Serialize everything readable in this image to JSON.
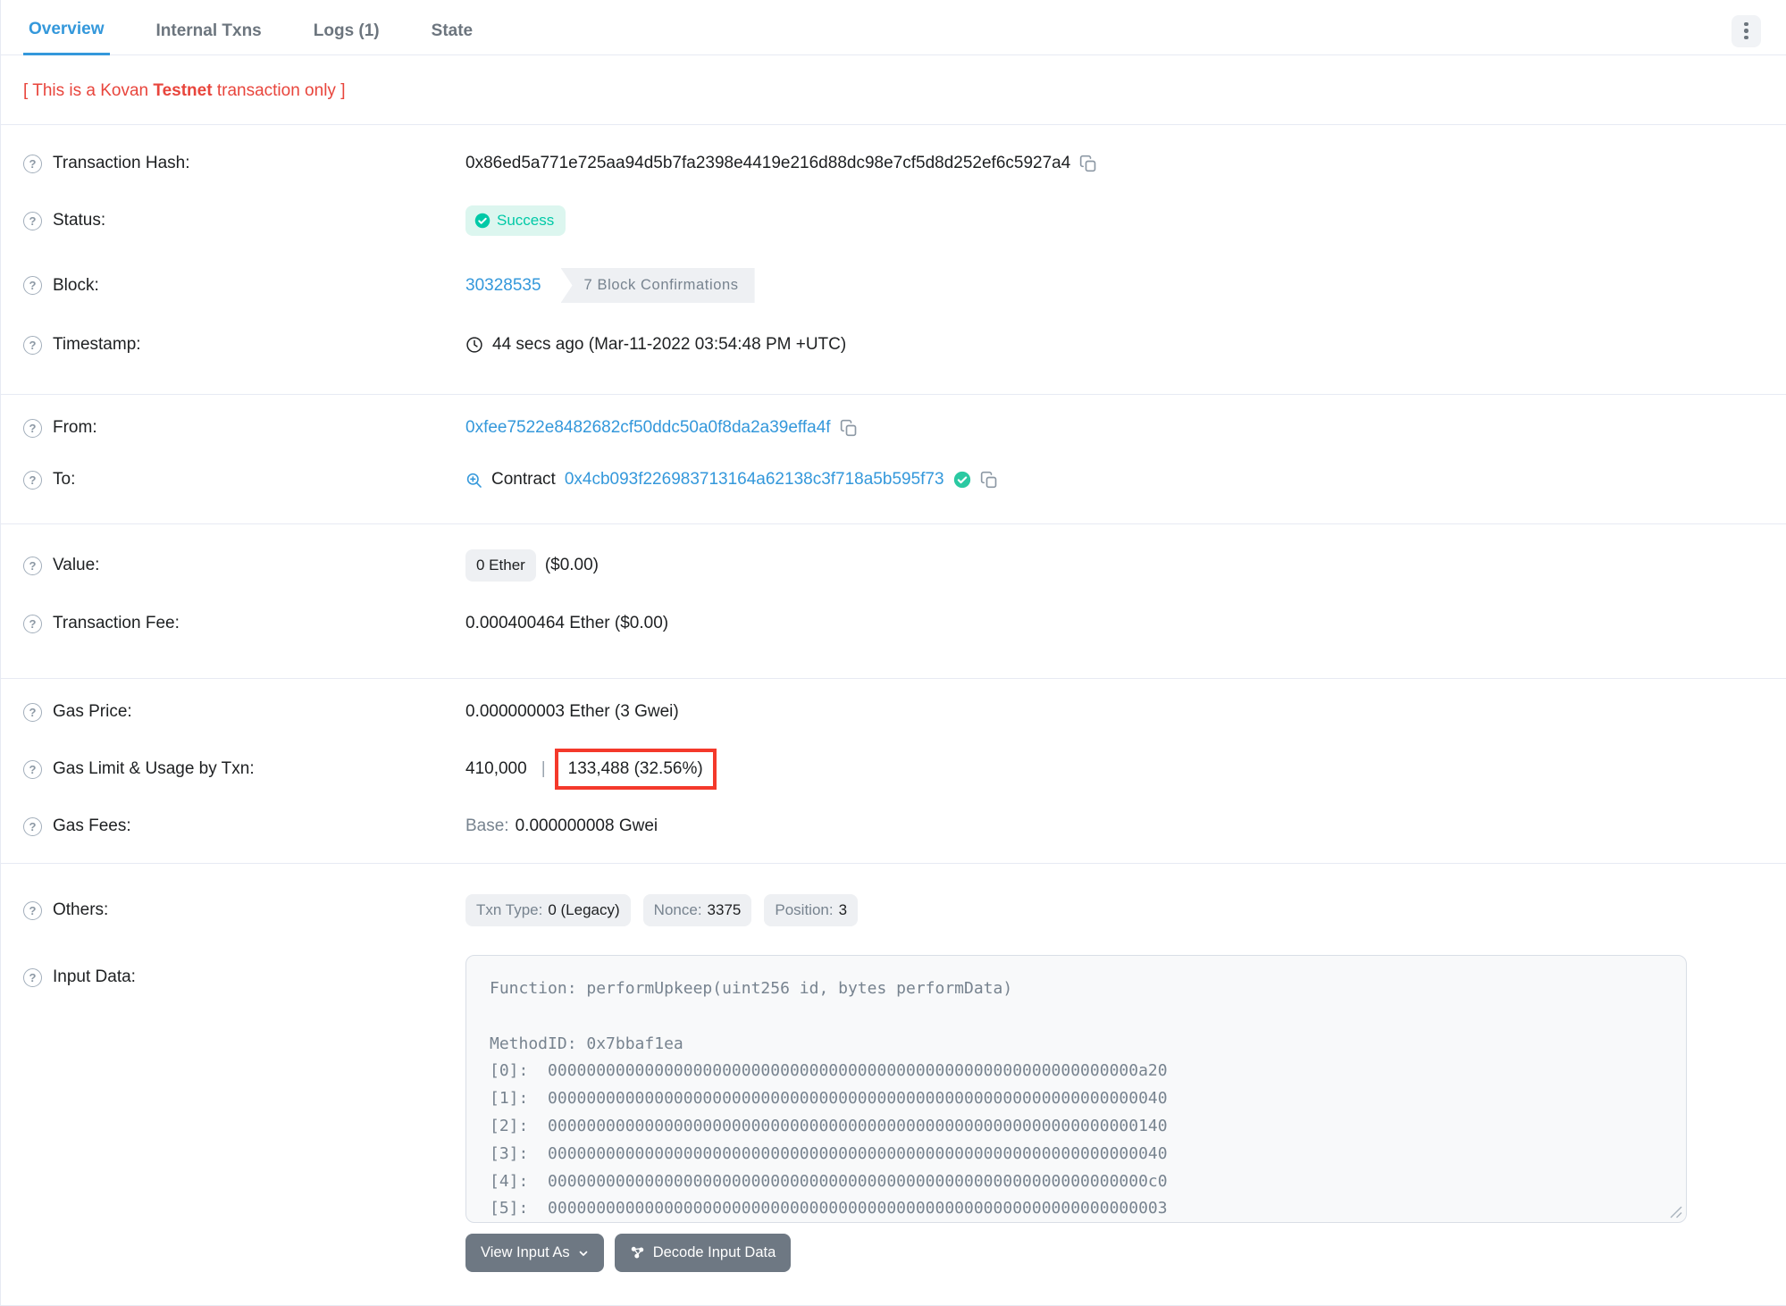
{
  "tabs": {
    "overview": "Overview",
    "internal_txns": "Internal Txns",
    "logs": "Logs (1)",
    "state": "State"
  },
  "notice": {
    "prefix": "[ This is a Kovan ",
    "bold": "Testnet",
    "suffix": " transaction only ]"
  },
  "icons": {
    "question_glyph": "?"
  },
  "rows": {
    "transaction_hash": {
      "label": "Transaction Hash:",
      "value": "0x86ed5a771e725aa94d5b7fa2398e4419e216d88dc98e7cf5d8d252ef6c5927a4"
    },
    "status": {
      "label": "Status:",
      "value": "Success"
    },
    "block": {
      "label": "Block:",
      "number": "30328535",
      "confirmations": "7 Block Confirmations"
    },
    "timestamp": {
      "label": "Timestamp:",
      "value": "44 secs ago (Mar-11-2022 03:54:48 PM +UTC)"
    },
    "from": {
      "label": "From:",
      "address": "0xfee7522e8482682cf50ddc50a0f8da2a39effa4f"
    },
    "to": {
      "label": "To:",
      "prefix": "Contract",
      "address": "0x4cb093f226983713164a62138c3f718a5b595f73"
    },
    "value": {
      "label": "Value:",
      "badge": "0 Ether",
      "usd": "($0.00)"
    },
    "transaction_fee": {
      "label": "Transaction Fee:",
      "value": "0.000400464 Ether ($0.00)"
    },
    "gas_price": {
      "label": "Gas Price:",
      "value": "0.000000003 Ether (3 Gwei)"
    },
    "gas_limit_usage": {
      "label": "Gas Limit & Usage by Txn:",
      "limit": "410,000",
      "separator": "|",
      "usage": "133,488 (32.56%)"
    },
    "gas_fees": {
      "label": "Gas Fees:",
      "base_label": "Base:",
      "base_value": "0.000000008 Gwei"
    },
    "others": {
      "label": "Others:",
      "badges": [
        {
          "name": "Txn Type:",
          "value": "0 (Legacy)"
        },
        {
          "name": "Nonce:",
          "value": "3375"
        },
        {
          "name": "Position:",
          "value": "3"
        }
      ]
    },
    "input_data": {
      "label": "Input Data:",
      "text": "Function: performUpkeep(uint256 id, bytes performData)\n\nMethodID: 0x7bbaf1ea\n[0]:  0000000000000000000000000000000000000000000000000000000000000a20\n[1]:  0000000000000000000000000000000000000000000000000000000000000040\n[2]:  0000000000000000000000000000000000000000000000000000000000000140\n[3]:  0000000000000000000000000000000000000000000000000000000000000040\n[4]:  00000000000000000000000000000000000000000000000000000000000000c0\n[5]:  0000000000000000000000000000000000000000000000000000000000000003"
    }
  },
  "buttons": {
    "view_input_as": "View Input As",
    "decode_input_data": "Decode Input Data"
  },
  "colors": {
    "link_blue": "#3498db",
    "success_teal": "#00c9a7",
    "danger_red": "#e8453c",
    "annotation_red": "#f4392b",
    "muted_gray": "#77838f",
    "divider": "#e7eaf3"
  }
}
